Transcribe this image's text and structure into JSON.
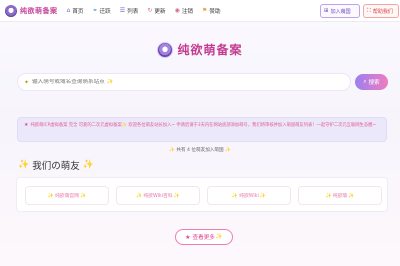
{
  "brand": {
    "name": "纯欲萌备案"
  },
  "nav": {
    "items": [
      {
        "icon": "home-icon",
        "glyph": "⌂",
        "label": "首页"
      },
      {
        "icon": "link-icon",
        "glyph": "⚭",
        "label": "迁跃"
      },
      {
        "icon": "list-icon",
        "glyph": "☰",
        "label": "列表"
      },
      {
        "icon": "refresh-icon",
        "glyph": "↻",
        "label": "更新"
      },
      {
        "icon": "lock-icon",
        "glyph": "◉",
        "label": "注销"
      },
      {
        "icon": "gift-icon",
        "glyph": "⚑",
        "label": "赞助"
      }
    ]
  },
  "header_buttons": {
    "join": {
      "icon": "plus-square-icon",
      "glyph": "⊞",
      "label": "加入萌国"
    },
    "help": {
      "icon": "gift-icon",
      "glyph": "⛶",
      "label": "帮助我们"
    }
  },
  "hero": {
    "title": "纯欲萌备案"
  },
  "search": {
    "placeholder": "输入萌号或域名查询萌系站点 ✨",
    "button_label": "搜索"
  },
  "notice": {
    "text": "纯欲萌ICP虚拟备案 完全 可爱的二次元虚拟备案✨ 欢迎各位萌友站长加入~ 申请后请于3天内在网站底部添加萌号，我们将审核并加入萌国萌友列表！一起守护二次元互联网生态圈~"
  },
  "count": {
    "text": "共有 4 位萌友加入萌国"
  },
  "friends": {
    "title": "我们の萌友",
    "items": [
      {
        "label": "纯欲萌官网"
      },
      {
        "label": "纯欲Wiki百科"
      },
      {
        "label": "纯欲Wiki"
      },
      {
        "label": "纯欲萌"
      }
    ]
  },
  "more": {
    "label": "查看更多"
  },
  "colors": {
    "brand_pink": "#c33c8f",
    "accent_purple": "#7b5cd0",
    "notice_bg": "#ece8fb",
    "help_red": "#d64848"
  }
}
